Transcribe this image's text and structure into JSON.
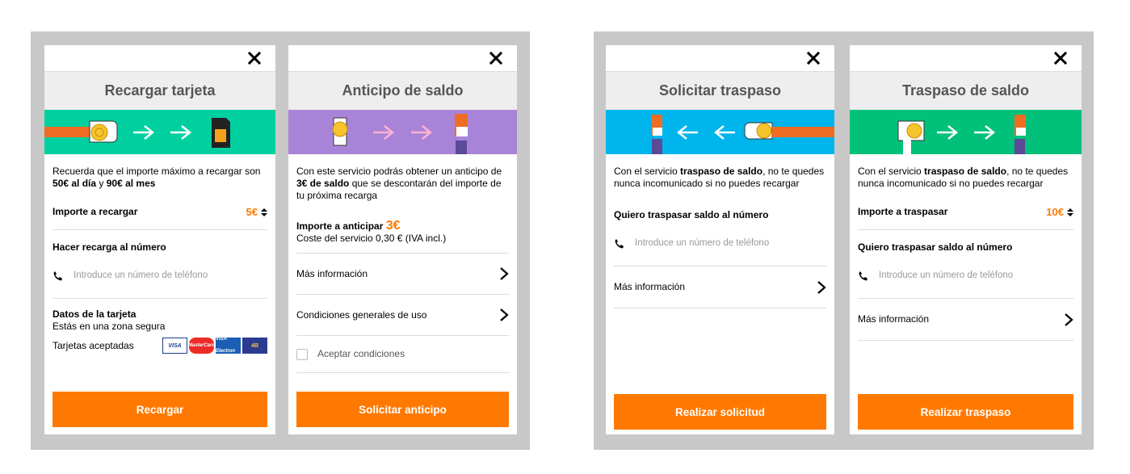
{
  "colors": {
    "accent": "#ff7900",
    "gray_frame": "#c8c8c8",
    "green_banner": "#00d0a0",
    "purple_banner": "#a884d8",
    "blue_banner": "#00b4ec",
    "green_banner2": "#00c07a"
  },
  "panel1": {
    "title": "Recargar tarjeta",
    "intro_line1": "Recuerda que el importe máximo a recargar son",
    "intro_b1": "50€ al día",
    "intro_mid": " y ",
    "intro_b2": "90€ al mes",
    "amount_label": "Importe a recargar",
    "amount_value": "5€",
    "number_label": "Hacer recarga al número",
    "phone_placeholder": "Introduce un número de teléfono",
    "card_label": "Datos de la tarjeta",
    "secure_text": "Estás en una zona segura",
    "accepted_label": "Tarjetas aceptadas",
    "cards": [
      "VISA",
      "MasterCard",
      "VISA Electron",
      "4B"
    ],
    "button": "Recargar"
  },
  "panel2": {
    "title": "Anticipo de saldo",
    "intro_a": "Con este servicio podrás obtener un anticipo de",
    "intro_b": "3€ de saldo",
    "intro_c": " que se descontarán del importe de tu próxima recarga",
    "advance_label": "Importe a anticipar",
    "advance_value": "3€",
    "cost_text": "Coste del servicio 0,30 € (IVA incl.)",
    "more_info": "Más información",
    "conditions": "Condiciones generales de uso",
    "accept": "Aceptar condiciones",
    "button": "Solicitar anticipo"
  },
  "panel3": {
    "title": "Solicitar traspaso",
    "intro_a": "Con el servicio ",
    "intro_b": "traspaso de saldo",
    "intro_c": ", no te quedes nunca incomunicado si no puedes recargar",
    "number_label": "Quiero traspasar saldo al número",
    "phone_placeholder": "Introduce un número de teléfono",
    "more_info": "Más información",
    "button": "Realizar solicitud"
  },
  "panel4": {
    "title": "Traspaso de saldo",
    "intro_a": "Con el servicio ",
    "intro_b": "traspaso de saldo",
    "intro_c": ", no te quedes nunca incomunicado si no puedes recargar",
    "amount_label": "Importe a traspasar",
    "amount_value": "10€",
    "number_label": "Quiero traspasar saldo al número",
    "phone_placeholder": "Introduce un número de teléfono",
    "more_info": "Más información",
    "button": "Realizar traspaso"
  }
}
